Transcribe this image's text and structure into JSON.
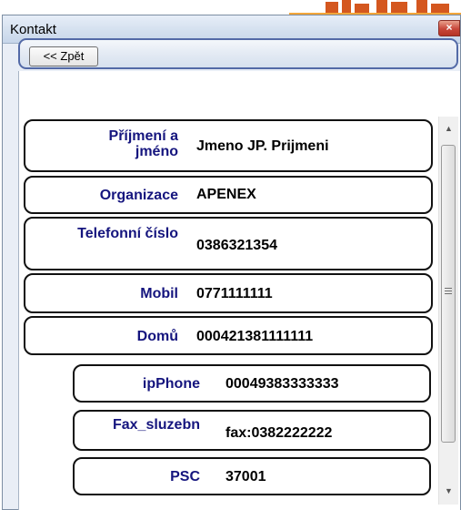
{
  "window": {
    "title": "Kontakt",
    "close_glyph": "×"
  },
  "toolbar": {
    "back_label": "<< Zpět"
  },
  "fields": [
    {
      "label": "Příjmení a jméno",
      "value": "Jmeno JP. Prijmeni"
    },
    {
      "label": "Organizace",
      "value": "APENEX"
    },
    {
      "label": "Telefonní číslo",
      "value": "0386321354"
    },
    {
      "label": "Mobil",
      "value": "0771111111"
    },
    {
      "label": "Domů",
      "value": "000421381111111"
    },
    {
      "label": "ipPhone",
      "value": "00049383333333"
    },
    {
      "label": "Fax_sluzebn",
      "value": "fax:0382222222"
    },
    {
      "label": "PSC",
      "value": "37001"
    }
  ],
  "icons": {
    "close": "close-icon",
    "scroll_up": "scroll-up-arrow-icon",
    "scroll_down": "scroll-down-arrow-icon",
    "grip": "scroll-grip-icon"
  },
  "colors": {
    "label_text": "#15157e",
    "field_border": "#111111",
    "toolbar_border": "#536aa7",
    "close_button": "#c8473a"
  }
}
